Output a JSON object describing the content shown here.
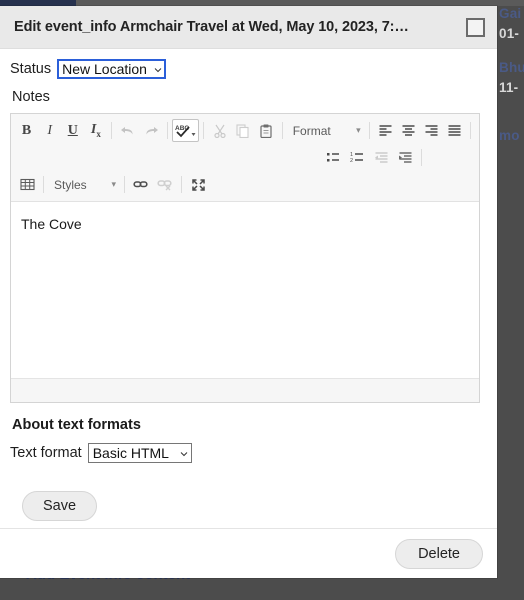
{
  "background": {
    "right_column": [
      {
        "kind": "link",
        "text": "Gai"
      },
      {
        "kind": "date",
        "text": "01-"
      },
      {
        "kind": "link",
        "text": "Bhu"
      },
      {
        "kind": "date",
        "text": "11-"
      },
      {
        "kind": "more",
        "text": "mo"
      }
    ],
    "bottom_row": {
      "bullet": "·",
      "label": "Add Event Info content"
    }
  },
  "dialog": {
    "title": "Edit event_info Armchair Travel at Wed, May 10, 2023, 7:…",
    "close_icon": "close-square-icon",
    "status": {
      "label": "Status",
      "value": "New Location",
      "options": [
        "New Location"
      ]
    },
    "notes": {
      "label": "Notes",
      "content": "The Cove"
    },
    "editor": {
      "toolbar_row1": [
        {
          "name": "bold-icon",
          "glyph": "B",
          "style": "tb-txt-b",
          "state": "normal"
        },
        {
          "name": "italic-icon",
          "glyph": "I",
          "style": "tb-txt-i",
          "state": "normal"
        },
        {
          "name": "underline-icon",
          "glyph": "U",
          "style": "tb-txt-u",
          "state": "normal"
        },
        {
          "name": "remove-format-icon",
          "glyph": "Ix",
          "style": "tb-txt-rm",
          "state": "normal"
        },
        {
          "name": "separator",
          "glyph": "",
          "style": "",
          "state": "sep"
        },
        {
          "name": "undo-icon",
          "glyph": "←",
          "style": "",
          "state": "disabled"
        },
        {
          "name": "redo-icon",
          "glyph": "→",
          "style": "",
          "state": "disabled"
        },
        {
          "name": "separator",
          "glyph": "",
          "style": "",
          "state": "sep"
        },
        {
          "name": "spell-check-icon",
          "glyph": "ABC",
          "style": "",
          "state": "boxed"
        },
        {
          "name": "separator",
          "glyph": "",
          "style": "",
          "state": "sep"
        },
        {
          "name": "cut-icon",
          "glyph": "✂",
          "style": "",
          "state": "disabled"
        },
        {
          "name": "copy-icon",
          "glyph": "❐",
          "style": "",
          "state": "disabled"
        },
        {
          "name": "paste-icon",
          "glyph": "Ὄb",
          "style": "",
          "state": "normal"
        },
        {
          "name": "separator",
          "glyph": "",
          "style": "",
          "state": "sep"
        }
      ],
      "format_combo": {
        "label": "Format",
        "arrow": "▾"
      },
      "align_buttons": [
        {
          "name": "align-left-icon"
        },
        {
          "name": "align-center-icon"
        },
        {
          "name": "align-right-icon"
        },
        {
          "name": "align-justify-icon"
        }
      ],
      "list_buttons": [
        {
          "name": "bulleted-list-icon"
        },
        {
          "name": "numbered-list-icon"
        },
        {
          "name": "outdent-icon"
        },
        {
          "name": "indent-icon"
        }
      ],
      "table_icon": "table-icon",
      "styles_combo": {
        "label": "Styles",
        "arrow": "▾"
      },
      "link_icon": "link-icon",
      "unlink_icon": "unlink-icon",
      "maximize_icon": "maximize-icon"
    },
    "about_text_formats": "About text formats",
    "text_format": {
      "label": "Text format",
      "value": "Basic HTML",
      "options": [
        "Basic HTML"
      ]
    },
    "save_label": "Save",
    "delete_label": "Delete"
  },
  "colors": {
    "backdrop": "#4c4c4c",
    "dialog_bg": "#ffffff",
    "header_bg": "#e9e9e9",
    "focus_blue": "#2b5fd9",
    "link_blue": "#4a5a86"
  }
}
